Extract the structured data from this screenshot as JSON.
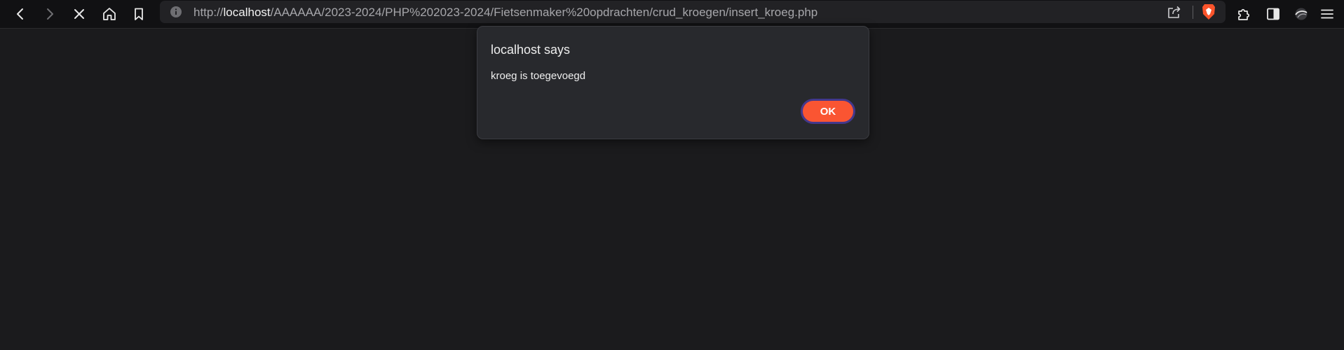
{
  "browser": {
    "url": {
      "prefix": "http://",
      "host": "localhost",
      "path": "/AAAAAA/2023-2024/PHP%202023-2024/Fietsenmaker%20opdrachten/crud_kroegen/insert_kroeg.php"
    },
    "icons": {
      "back": "back-icon",
      "forward": "forward-icon",
      "stop": "close-icon",
      "home": "home-icon",
      "bookmark": "bookmark-icon",
      "info": "info-icon",
      "share": "share-icon",
      "brave": "brave-shields-icon",
      "extensions": "puzzle-icon",
      "sidebar": "sidebar-icon",
      "wallet": "wallet-icon",
      "menu": "menu-icon"
    },
    "colors": {
      "accent": "#fa5532",
      "page_bg": "#1b1b1d",
      "toolbar_bg": "#111113"
    }
  },
  "dialog": {
    "title": "localhost says",
    "message": "kroeg is toegevoegd",
    "ok_label": "OK"
  }
}
